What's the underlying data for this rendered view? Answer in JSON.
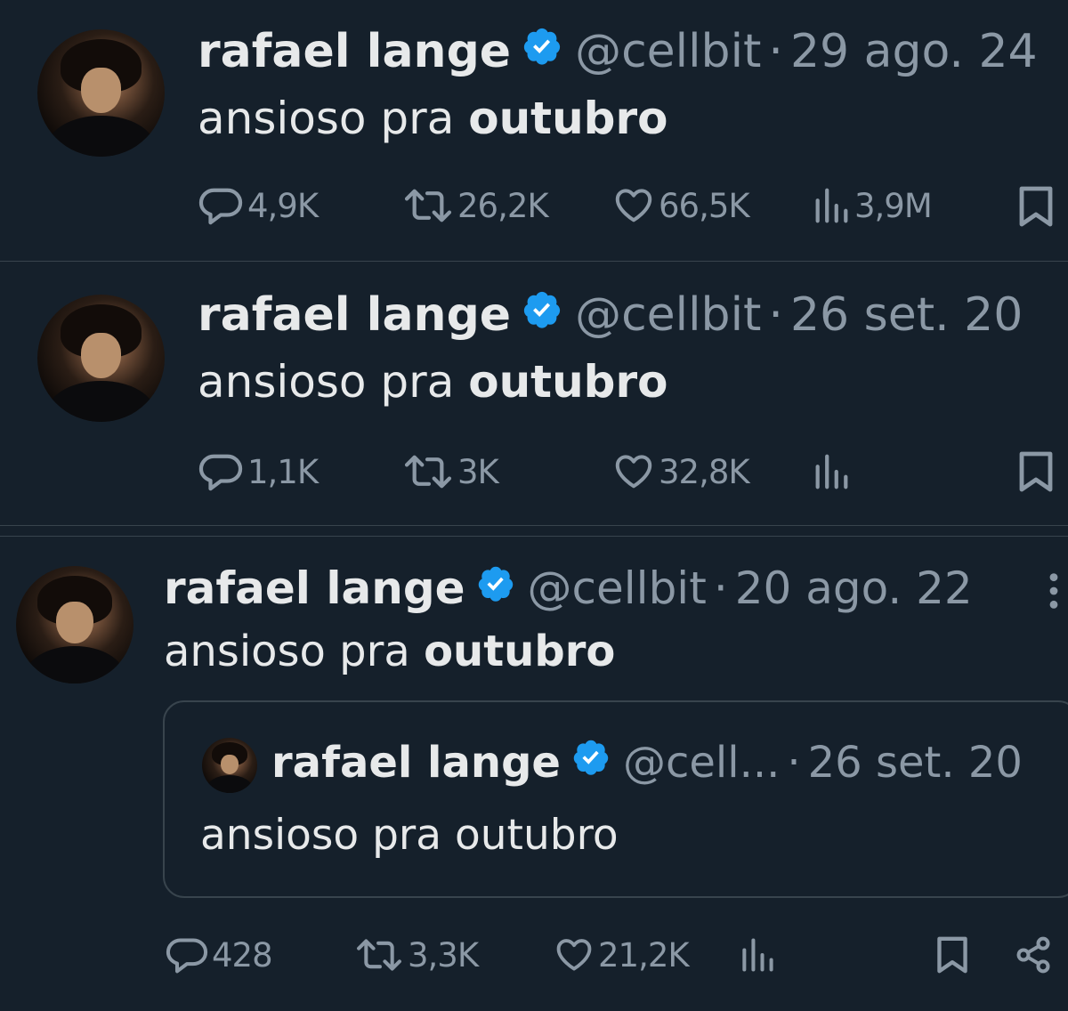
{
  "colors": {
    "background": "#15202b",
    "text": "#e7e9ea",
    "muted": "#8b98a5",
    "verified": "#1d9bf0",
    "divider": "#38444d"
  },
  "tweets": [
    {
      "name": "rafael lange",
      "handle": "@cellbit",
      "dot": "·",
      "date": "29 ago. 24",
      "text_plain": "ansioso pra ",
      "text_bold": "outubro",
      "replies": "4,9K",
      "retweets": "26,2K",
      "likes": "66,5K",
      "views": "3,9M"
    },
    {
      "name": "rafael lange",
      "handle": "@cellbit",
      "dot": "·",
      "date": "26 set. 20",
      "text_plain": "ansioso pra ",
      "text_bold": "outubro",
      "replies": "1,1K",
      "retweets": "3K",
      "likes": "32,8K",
      "views": ""
    },
    {
      "name": "rafael lange",
      "handle": "@cellbit",
      "dot": "·",
      "date": "20 ago. 22",
      "text_plain": "ansioso pra ",
      "text_bold": "outubro",
      "replies": "428",
      "retweets": "3,3K",
      "likes": "21,2K",
      "views": "",
      "quoted": {
        "name": "rafael lange",
        "handle": "@cell...",
        "dot": "·",
        "date": "26 set. 20",
        "text": "ansioso pra outubro"
      }
    }
  ],
  "icons": [
    "reply-icon",
    "retweet-icon",
    "like-icon",
    "views-icon",
    "bookmark-icon",
    "more-icon",
    "share-icon",
    "verified-icon"
  ]
}
